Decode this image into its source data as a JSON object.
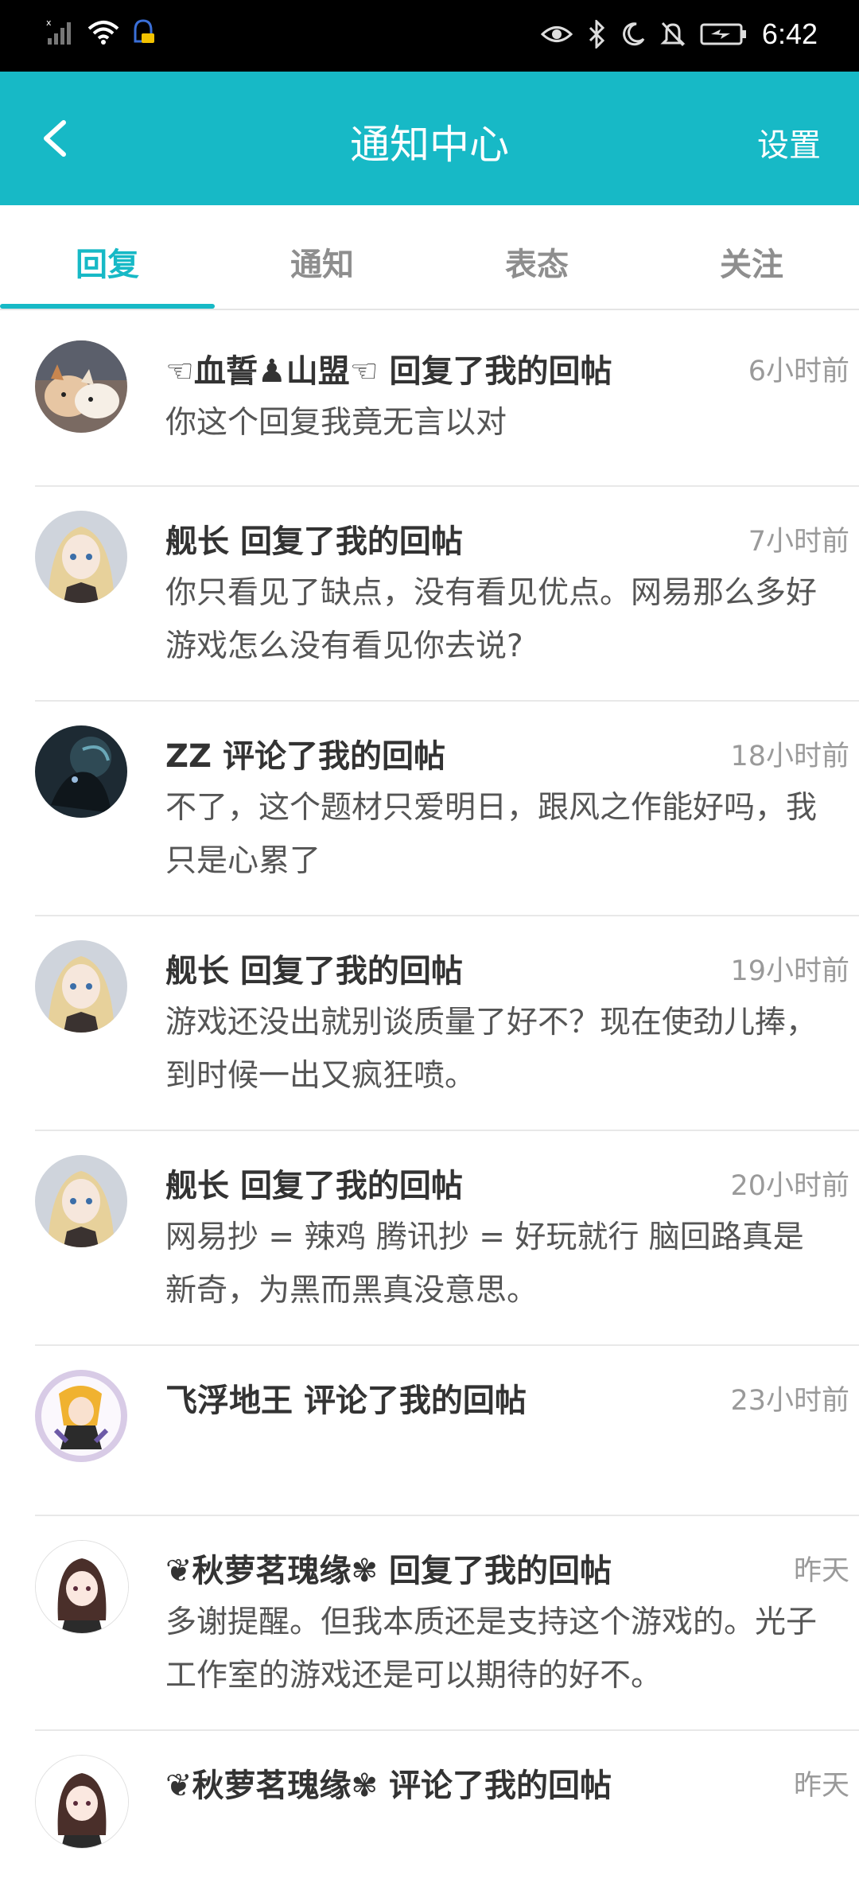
{
  "status_bar": {
    "time": "6:42"
  },
  "app_bar": {
    "title": "通知中心",
    "right_action": "设置"
  },
  "tabs": [
    {
      "label": "回复",
      "active": true
    },
    {
      "label": "通知",
      "active": false
    },
    {
      "label": "表态",
      "active": false
    },
    {
      "label": "关注",
      "active": false
    }
  ],
  "notifications": [
    {
      "user": "☜血誓♟山盟☜",
      "action": "回复了我的回帖",
      "time": "6小时前",
      "content": "你这个回复我竟无言以对"
    },
    {
      "user": "舰长",
      "action": "回复了我的回帖",
      "time": "7小时前",
      "content": "你只看见了缺点，没有看见优点。网易那么多好游戏怎么没有看见你去说?"
    },
    {
      "user": "ZZ",
      "action": "评论了我的回帖",
      "time": "18小时前",
      "content": "不了，这个题材只爱明日，跟风之作能好吗，我只是心累了"
    },
    {
      "user": "舰长",
      "action": "回复了我的回帖",
      "time": "19小时前",
      "content": "游戏还没出就别谈质量了好不？现在使劲儿捧，到时候一出又疯狂喷。"
    },
    {
      "user": "舰长",
      "action": "回复了我的回帖",
      "time": "20小时前",
      "content": "网易抄 = 辣鸡 腾讯抄 = 好玩就行 脑回路真是新奇，为黑而黑真没意思。"
    },
    {
      "user": "飞浮地王",
      "action": "评论了我的回帖",
      "time": "23小时前",
      "content": ""
    },
    {
      "user": "❦秋萝茗瑰缘✾",
      "action": "回复了我的回帖",
      "time": "昨天",
      "content": "多谢提醒。但我本质还是支持这个游戏的。光子工作室的游戏还是可以期待的好不。"
    },
    {
      "user": "❦秋萝茗瑰缘✾",
      "action": "评论了我的回帖",
      "time": "昨天",
      "content": ""
    }
  ]
}
